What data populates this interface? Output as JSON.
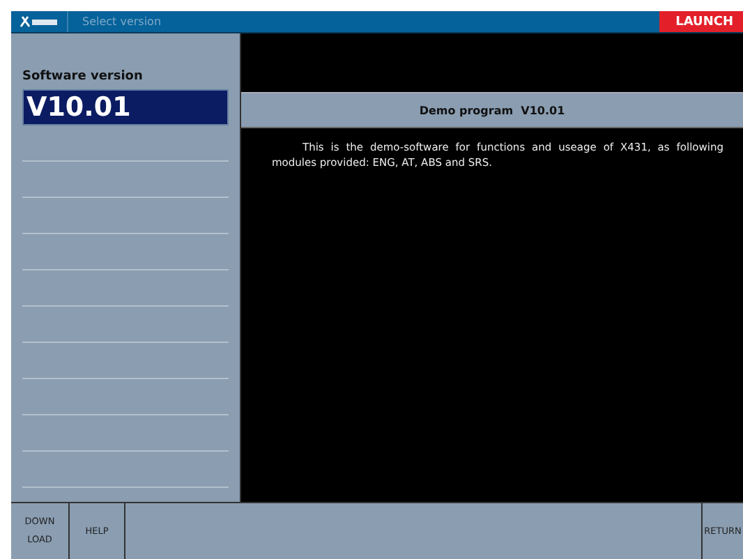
{
  "window": {
    "title": "Select version",
    "brand": "LAUNCH"
  },
  "sidebar": {
    "heading": "Software version",
    "items": [
      {
        "label": "V10.01",
        "selected": true
      }
    ]
  },
  "content": {
    "header": "Demo program  V10.01",
    "body": "This is the demo-software for functions and useage of X431, as following modules provided: ENG, AT, ABS and SRS."
  },
  "buttons": [
    {
      "label": "DOWN LOAD",
      "kind": "left"
    },
    {
      "label": "HELP",
      "kind": "left"
    },
    {
      "label": "RETURN",
      "kind": "right"
    }
  ]
}
